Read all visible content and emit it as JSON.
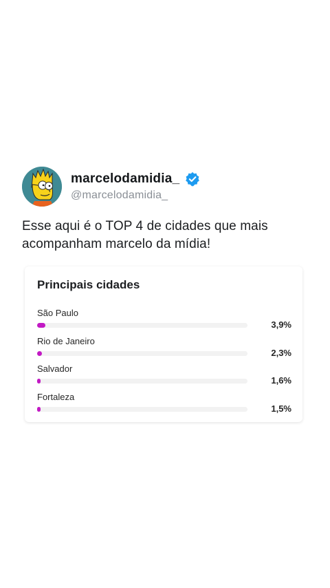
{
  "profile": {
    "display_name": "marcelodamidia_",
    "handle": "@marcelodamidia_",
    "verified": true,
    "avatar_icon": "cartoon-avatar-icon",
    "verified_color": "#1d9bf0"
  },
  "tweet": {
    "text": "Esse aqui é o TOP 4 de cidades que mais acompanham marcelo da mídia!"
  },
  "card": {
    "title": "Principais cidades",
    "bar_color": "#c21ac4",
    "cities": [
      {
        "name": "São Paulo",
        "percent_label": "3,9%",
        "value": 3.9
      },
      {
        "name": "Rio de Janeiro",
        "percent_label": "2,3%",
        "value": 2.3
      },
      {
        "name": "Salvador",
        "percent_label": "1,6%",
        "value": 1.6
      },
      {
        "name": "Fortaleza",
        "percent_label": "1,5%",
        "value": 1.5
      }
    ]
  }
}
